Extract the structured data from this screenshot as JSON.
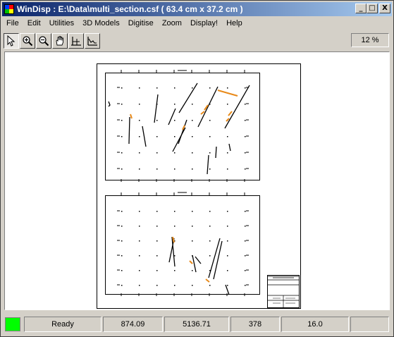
{
  "window": {
    "title": "WinDisp : E:\\Data\\multi_section.csf ( 63.4 cm x 37.2 cm )",
    "buttons": {
      "minimize": "_",
      "maximize": "□",
      "close": "X"
    }
  },
  "menu": [
    "File",
    "Edit",
    "Utilities",
    "3D Models",
    "Digitise",
    "Zoom",
    "Display!",
    "Help"
  ],
  "toolbar": {
    "tools": [
      "arrow-pointer-icon",
      "zoom-in-icon",
      "zoom-out-icon",
      "hand-pan-icon",
      "section-tool-icon",
      "profile-tool-icon"
    ],
    "zoom_level": "12 %"
  },
  "colors": {
    "title_start": "#0a246a",
    "title_end": "#a6caf0",
    "status_indicator": "#00ff00",
    "fault_orange": "#e88a1a"
  },
  "status": {
    "state": "Ready",
    "x": "874.09",
    "y": "5136.71",
    "field3": "378",
    "field4": "16.0",
    "field5": ""
  }
}
